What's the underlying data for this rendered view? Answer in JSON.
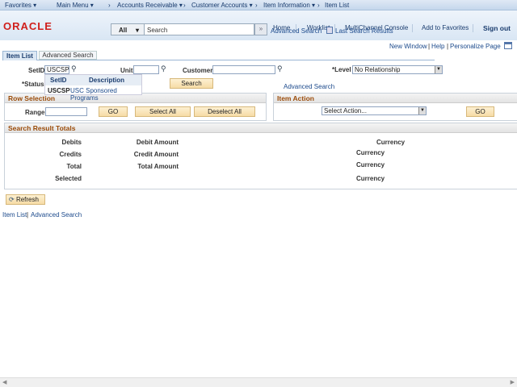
{
  "nav": {
    "favorites": "Favorites ▾",
    "main_menu": "Main Menu ▾",
    "breadcrumbs": [
      "Accounts Receivable ▾",
      "Customer Accounts ▾",
      "Item Information ▾",
      "Item List"
    ]
  },
  "header": {
    "logo": "ORACLE",
    "links": [
      "Home",
      "Worklist",
      "MultiChannel Console",
      "Add to Favorites",
      "Sign out"
    ],
    "search_scope": "All",
    "search_placeholder": "Search",
    "advanced_search": "Advanced Search",
    "last_search_results": "Last Search Results"
  },
  "page_links": {
    "new_window": "New Window",
    "help": "Help",
    "personalize": "Personalize Page"
  },
  "tabs": [
    "Item List",
    "Advanced Search"
  ],
  "form": {
    "setid_label": "SetID",
    "setid_value": "USCSP",
    "unit_label": "Unit",
    "customer_label": "Customer",
    "level_label": "*Level",
    "level_value": "No Relationship",
    "status_label": "*Status",
    "search_button": "Search",
    "advanced_search": "Advanced Search"
  },
  "dropdown": {
    "col_setid": "SetID",
    "col_description": "Description",
    "row_setid": "USCSP",
    "row_description": "USC Sponsored Programs"
  },
  "row_selection": {
    "title": "Row Selection",
    "range_label": "Range",
    "go": "GO",
    "select_all": "Select All",
    "deselect_all": "Deselect All"
  },
  "item_action": {
    "title": "Item Action",
    "select_value": "Select Action...",
    "go": "GO"
  },
  "totals": {
    "title": "Search Result Totals",
    "debits": "Debits",
    "credits": "Credits",
    "total": "Total",
    "selected": "Selected",
    "debit_amount": "Debit Amount",
    "credit_amount": "Credit Amount",
    "total_amount": "Total Amount",
    "currency": "Currency"
  },
  "refresh": "Refresh",
  "footer_links": [
    "Item List",
    "Advanced Search"
  ]
}
